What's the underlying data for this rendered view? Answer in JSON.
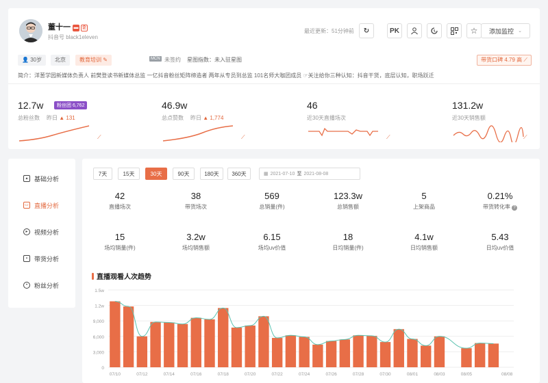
{
  "profile": {
    "name": "董十一",
    "douyin_id": "抖音号 black1eleven",
    "last_update": "最近更新：51分钟前",
    "pk_label": "PK",
    "watch_label": "添加监控",
    "tags": {
      "age": "30岁",
      "region": "北京",
      "category": "教育培训",
      "mcn_chip": "MCN",
      "mcn_status": "未签约",
      "star_index": "星图指数：未入驻星图",
      "reputation": "带货口碑 4.79 高"
    },
    "bio": "简介：洋葱学园新媒体负责人 前樊登读书新媒体总监 一亿抖音粉丝矩阵缔造者 两年从专员到总监 101名师大咖团成员 ☞关注给你三种认知：抖音干货，底层认知，职场跃迁"
  },
  "stats": [
    {
      "value": "12.7w",
      "label": "总粉丝数",
      "sub": "昨日",
      "delta": "131",
      "badge": "粉丝团 6,762"
    },
    {
      "value": "46.9w",
      "label": "总点赞数",
      "sub": "昨日",
      "delta": "1,774"
    },
    {
      "value": "46",
      "label": "近30天直播场次"
    },
    {
      "value": "131.2w",
      "label": "近30天销售额"
    }
  ],
  "nav": [
    {
      "label": "基础分析",
      "icon": "chart-icon"
    },
    {
      "label": "直播分析",
      "icon": "live-icon",
      "active": true
    },
    {
      "label": "视频分析",
      "icon": "play-icon"
    },
    {
      "label": "带货分析",
      "icon": "cart-icon"
    },
    {
      "label": "粉丝分析",
      "icon": "user-icon"
    }
  ],
  "ranges": [
    "7天",
    "15天",
    "30天",
    "90天",
    "180天",
    "360天"
  ],
  "active_range": "30天",
  "date_range": {
    "start": "2021-07-10",
    "sep": "至",
    "end": "2021-08-08"
  },
  "metrics": [
    {
      "value": "42",
      "label": "直播场次"
    },
    {
      "value": "38",
      "label": "带货场次"
    },
    {
      "value": "569",
      "label": "总销量(件)"
    },
    {
      "value": "123.3w",
      "label": "总销售额"
    },
    {
      "value": "5",
      "label": "上架商品"
    },
    {
      "value": "0.21%",
      "label": "带货转化率"
    },
    {
      "value": "15",
      "label": "场均销量(件)"
    },
    {
      "value": "3.2w",
      "label": "场均销售额"
    },
    {
      "value": "6.15",
      "label": "场均uv价值"
    },
    {
      "value": "18",
      "label": "日均销量(件)"
    },
    {
      "value": "4.1w",
      "label": "日均销售额"
    },
    {
      "value": "5.43",
      "label": "日均uv价值"
    }
  ],
  "section_title": "直播观看人次趋势",
  "colors": {
    "accent": "#e86e47",
    "line": "#5bc2b0",
    "badge_purple": "#8b4fc7"
  },
  "chart_data": {
    "type": "bar",
    "title": "直播观看人次趋势",
    "xlabel": "",
    "ylabel": "",
    "ylim": [
      0,
      15000
    ],
    "yticks": [
      "0",
      "3,000",
      "6,000",
      "9,000",
      "1.2w",
      "1.5w"
    ],
    "x_ticks": [
      "07/10",
      "07/12",
      "07/14",
      "07/16",
      "07/18",
      "07/20",
      "07/22",
      "07/24",
      "07/26",
      "07/28",
      "07/30",
      "08/01",
      "08/03",
      "08/05",
      "08/08"
    ],
    "categories": [
      "07/10",
      "07/11",
      "07/12",
      "07/13",
      "07/14",
      "07/15",
      "07/16",
      "07/17",
      "07/18",
      "07/19",
      "07/20",
      "07/21",
      "07/22",
      "07/23",
      "07/24",
      "07/25",
      "07/26",
      "07/27",
      "07/28",
      "07/29",
      "07/30",
      "07/31",
      "08/01",
      "08/02",
      "08/03",
      "08/04",
      "08/05",
      "08/06",
      "08/07",
      "08/08"
    ],
    "series": [
      {
        "type": "bar",
        "values": [
          12800,
          11800,
          6000,
          8800,
          8700,
          8400,
          9600,
          9300,
          11500,
          7700,
          8100,
          9900,
          5700,
          6200,
          5900,
          4400,
          5100,
          5400,
          6200,
          6100,
          4900,
          7400,
          5500,
          4200,
          6000,
          0,
          3700,
          4700,
          4600,
          0
        ]
      },
      {
        "type": "line",
        "values": [
          12800,
          11800,
          6000,
          8800,
          8700,
          8400,
          9600,
          9300,
          11500,
          7700,
          8100,
          9900,
          5700,
          6200,
          5900,
          4400,
          5100,
          5400,
          6200,
          6100,
          4900,
          7400,
          5500,
          4200,
          6000,
          null,
          3700,
          4700,
          4600,
          null
        ]
      }
    ],
    "grid": true
  }
}
